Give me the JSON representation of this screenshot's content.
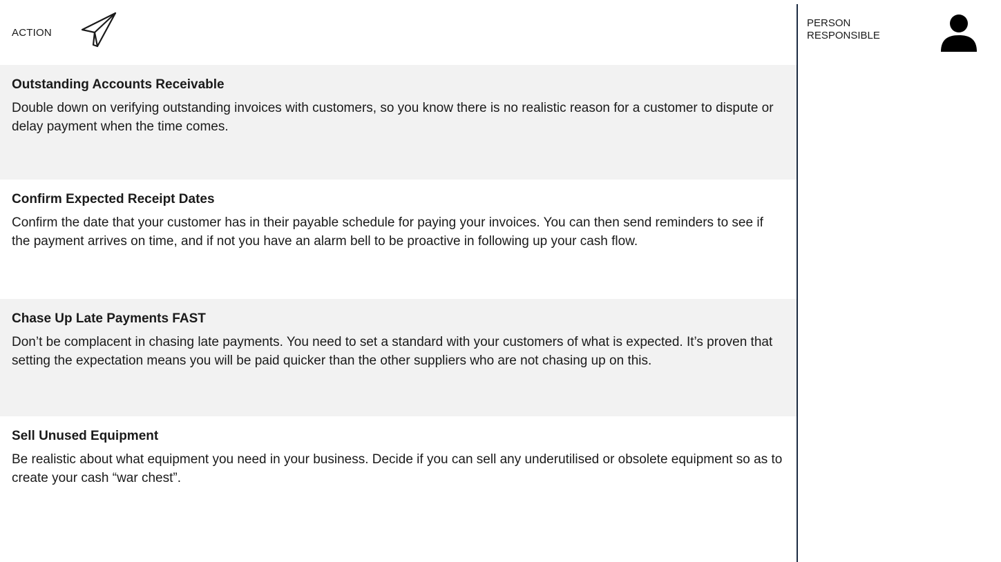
{
  "header": {
    "action_label": "ACTION",
    "action_icon": "paper-plane-icon",
    "person_label_line1": "PERSON",
    "person_label_line2": "RESPONSIBLE",
    "person_icon": "person-icon"
  },
  "rows": [
    {
      "title": "Outstanding Accounts Receivable",
      "description": "Double down on verifying outstanding invoices with customers, so you know there is no realistic reason for a customer to dispute or delay payment when the time comes."
    },
    {
      "title": "Confirm Expected Receipt Dates",
      "description": "Confirm the date that your customer has in their payable schedule for paying your invoices. You can then send reminders to see if the payment arrives on time, and if not you have an alarm bell to be proactive in following up your cash flow."
    },
    {
      "title": "Chase Up Late Payments FAST",
      "description": "Don’t be complacent in chasing late payments. You need to set a standard with your customers of what is expected. It’s proven that setting the expectation means you will be paid quicker than the other suppliers who are not chasing up on this."
    },
    {
      "title": "Sell Unused Equipment",
      "description": "Be realistic about what equipment you need in your business. Decide if you can sell any underutilised or obsolete equipment so as to create your cash “war chest”."
    }
  ],
  "colors": {
    "row_shade": "#f2f2f2",
    "divider": "#1b2a41",
    "text": "#1a1a1a"
  }
}
